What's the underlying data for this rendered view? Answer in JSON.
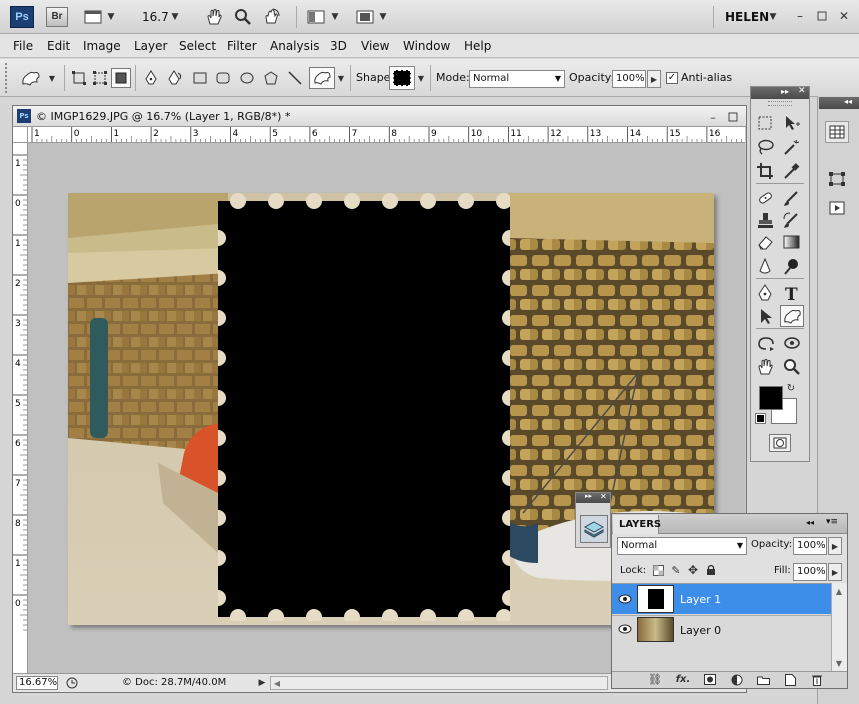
{
  "app": {
    "logo": "Ps",
    "bridge": "Br",
    "zoom": "16.7",
    "user": "HELEN"
  },
  "menu": [
    "File",
    "Edit",
    "Image",
    "Layer",
    "Select",
    "Filter",
    "Analysis",
    "3D",
    "View",
    "Window",
    "Help"
  ],
  "options": {
    "shape_label": "Shape:",
    "mode_label": "Mode:",
    "mode_value": "Normal",
    "opacity_label": "Opacity:",
    "opacity_value": "100%",
    "antialias_label": "Anti-alias"
  },
  "document": {
    "title": "© IMGP1629.JPG @ 16.7% (Layer 1, RGB/8*) *",
    "zoom": "16.67%",
    "doc_info": "© Doc: 28.7M/40.0M",
    "ruler_h": [
      "1",
      "0",
      "1",
      "2",
      "3",
      "4",
      "5",
      "6",
      "7",
      "8",
      "9",
      "10",
      "11",
      "12",
      "13",
      "14",
      "15",
      "16"
    ],
    "ruler_v": [
      "1",
      "0",
      "1",
      "2",
      "3",
      "4",
      "5",
      "6",
      "7",
      "8",
      "1",
      "0"
    ]
  },
  "layers": {
    "tab": "LAYERS",
    "blend": "Normal",
    "opacity_label": "Opacity:",
    "opacity_value": "100%",
    "lock_label": "Lock:",
    "fill_label": "Fill:",
    "fill_value": "100%",
    "items": [
      {
        "name": "Layer 1"
      },
      {
        "name": "Layer 0"
      }
    ]
  },
  "colors": {
    "accent": "#3d8ee8",
    "selected_row": "#3d8ee8"
  }
}
